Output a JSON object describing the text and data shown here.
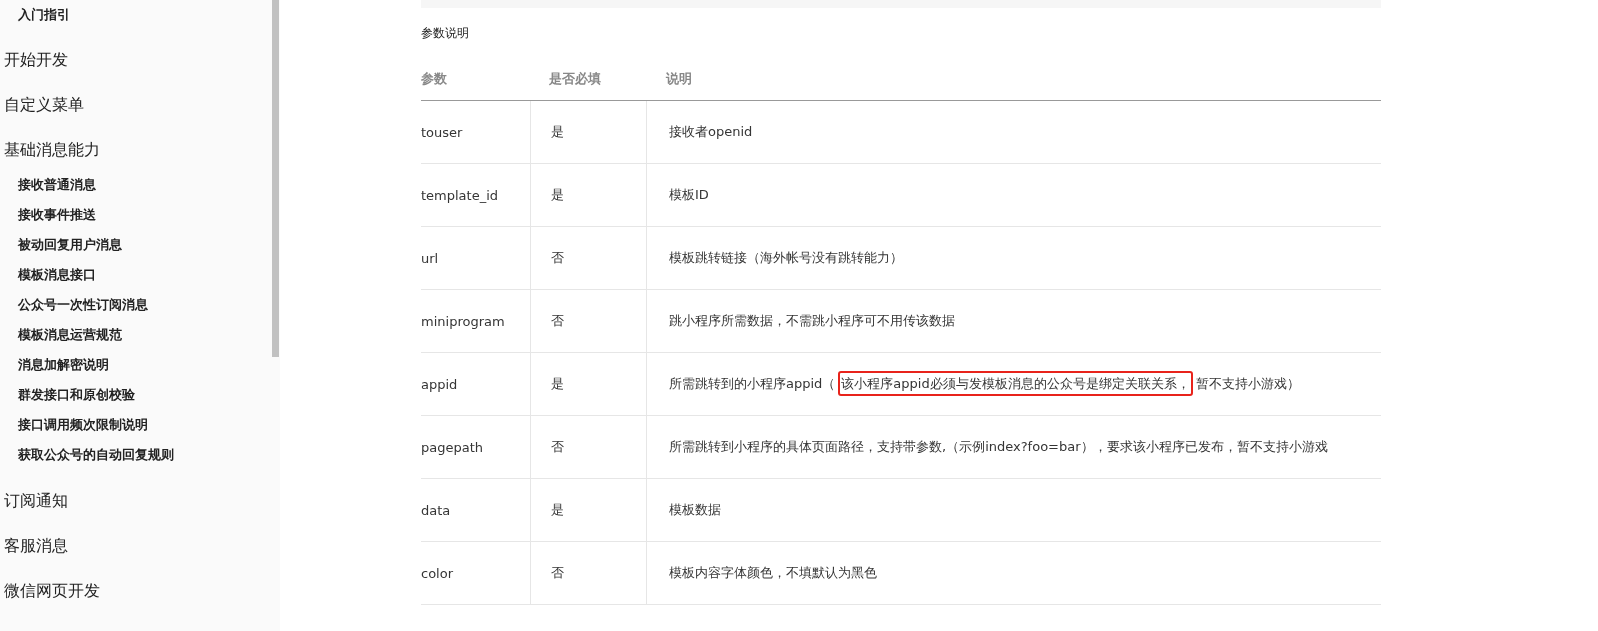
{
  "sidebar": {
    "items": [
      {
        "label": "入门指引",
        "kind": "page"
      },
      {
        "label": "开始开发",
        "kind": "section"
      },
      {
        "label": "自定义菜单",
        "kind": "section"
      },
      {
        "label": "基础消息能力",
        "kind": "section",
        "children": [
          {
            "label": "接收普通消息"
          },
          {
            "label": "接收事件推送"
          },
          {
            "label": "被动回复用户消息"
          },
          {
            "label": "模板消息接口"
          },
          {
            "label": "公众号一次性订阅消息"
          },
          {
            "label": "模板消息运营规范"
          },
          {
            "label": "消息加解密说明"
          },
          {
            "label": "群发接口和原创校验"
          },
          {
            "label": "接口调用频次限制说明"
          },
          {
            "label": "获取公众号的自动回复规则"
          }
        ]
      },
      {
        "label": "订阅通知",
        "kind": "section"
      },
      {
        "label": "客服消息",
        "kind": "section"
      },
      {
        "label": "微信网页开发",
        "kind": "section"
      }
    ]
  },
  "content": {
    "section_title": "参数说明",
    "table": {
      "columns": [
        "参数",
        "是否必填",
        "说明"
      ],
      "rows": [
        {
          "param": "touser",
          "required": "是",
          "description": [
            {
              "text": "接收者openid",
              "highlighted": false
            }
          ]
        },
        {
          "param": "template_id",
          "required": "是",
          "description": [
            {
              "text": "模板ID",
              "highlighted": false
            }
          ]
        },
        {
          "param": "url",
          "required": "否",
          "description": [
            {
              "text": "模板跳转链接（海外帐号没有跳转能力）",
              "highlighted": false
            }
          ]
        },
        {
          "param": "miniprogram",
          "required": "否",
          "description": [
            {
              "text": "跳小程序所需数据，不需跳小程序可不用传该数据",
              "highlighted": false
            }
          ]
        },
        {
          "param": "appid",
          "required": "是",
          "description": [
            {
              "text": "所需跳转到的小程序appid（",
              "highlighted": false
            },
            {
              "text": "该小程序appid必须与发模板消息的公众号是绑定关联关系，",
              "highlighted": true
            },
            {
              "text": "暂不支持小游戏）",
              "highlighted": false
            }
          ]
        },
        {
          "param": "pagepath",
          "required": "否",
          "description": [
            {
              "text": "所需跳转到小程序的具体页面路径，支持带参数,（示例index?foo=bar），要求该小程序已发布，暂不支持小游戏",
              "highlighted": false
            }
          ]
        },
        {
          "param": "data",
          "required": "是",
          "description": [
            {
              "text": "模板数据",
              "highlighted": false
            }
          ]
        },
        {
          "param": "color",
          "required": "否",
          "description": [
            {
              "text": "模板内容字体颜色，不填默认为黑色",
              "highlighted": false
            }
          ]
        }
      ]
    }
  }
}
